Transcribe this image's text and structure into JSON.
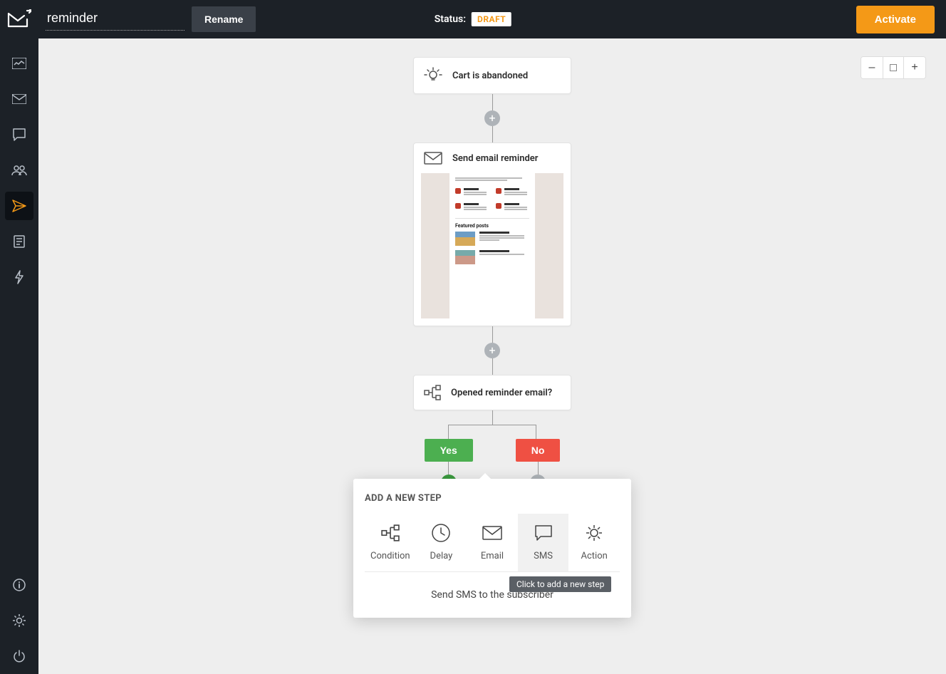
{
  "header": {
    "workflow_name": "reminder",
    "rename_label": "Rename",
    "status_label": "Status:",
    "status_value": "DRAFT",
    "activate_label": "Activate"
  },
  "sidebar": {
    "items": [
      "dashboard",
      "mail",
      "chat",
      "users",
      "send",
      "list",
      "bolt"
    ],
    "bottom": [
      "info",
      "settings",
      "power"
    ],
    "active_index": 4
  },
  "zoom": {
    "minus": "–",
    "reset": "",
    "plus": "+"
  },
  "flow": {
    "trigger": {
      "title": "Cart is abandoned"
    },
    "email": {
      "title": "Send email reminder",
      "preview_heading": "Featured posts"
    },
    "condition": {
      "title": "Opened reminder email?"
    },
    "branches": {
      "yes": "Yes",
      "no": "No"
    }
  },
  "popover": {
    "title": "ADD A NEW STEP",
    "options": [
      {
        "key": "condition",
        "label": "Condition"
      },
      {
        "key": "delay",
        "label": "Delay"
      },
      {
        "key": "email",
        "label": "Email"
      },
      {
        "key": "sms",
        "label": "SMS"
      },
      {
        "key": "action",
        "label": "Action"
      }
    ],
    "selected": "sms",
    "description": "Send SMS to the subscriber",
    "tooltip": "Click to add a new step"
  }
}
